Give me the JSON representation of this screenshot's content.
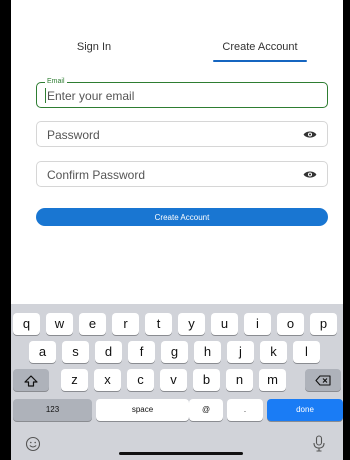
{
  "tabs": [
    {
      "label": "Sign In",
      "active": false
    },
    {
      "label": "Create Account",
      "active": true
    }
  ],
  "form": {
    "email": {
      "legend": "Email",
      "placeholder": "Enter your email",
      "value": ""
    },
    "password": {
      "placeholder": "Password",
      "value": ""
    },
    "confirm": {
      "placeholder": "Confirm Password",
      "value": ""
    },
    "submit_label": "Create Account"
  },
  "keyboard": {
    "row1": [
      "q",
      "w",
      "e",
      "r",
      "t",
      "y",
      "u",
      "i",
      "o",
      "p"
    ],
    "row2": [
      "a",
      "s",
      "d",
      "f",
      "g",
      "h",
      "j",
      "k",
      "l"
    ],
    "row3": [
      "z",
      "x",
      "c",
      "v",
      "b",
      "n",
      "m"
    ],
    "numbers_label": "123",
    "space_label": "space",
    "at_label": "@",
    "dot_label": ".",
    "done_label": "done"
  },
  "colors": {
    "accent": "#1976d2",
    "focus": "#2e7d32",
    "done_key": "#1a7cf5",
    "keyboard_bg": "#d1d3d9"
  },
  "icons": [
    "eye-icon",
    "shift-icon",
    "backspace-icon",
    "emoji-icon",
    "microphone-icon"
  ]
}
